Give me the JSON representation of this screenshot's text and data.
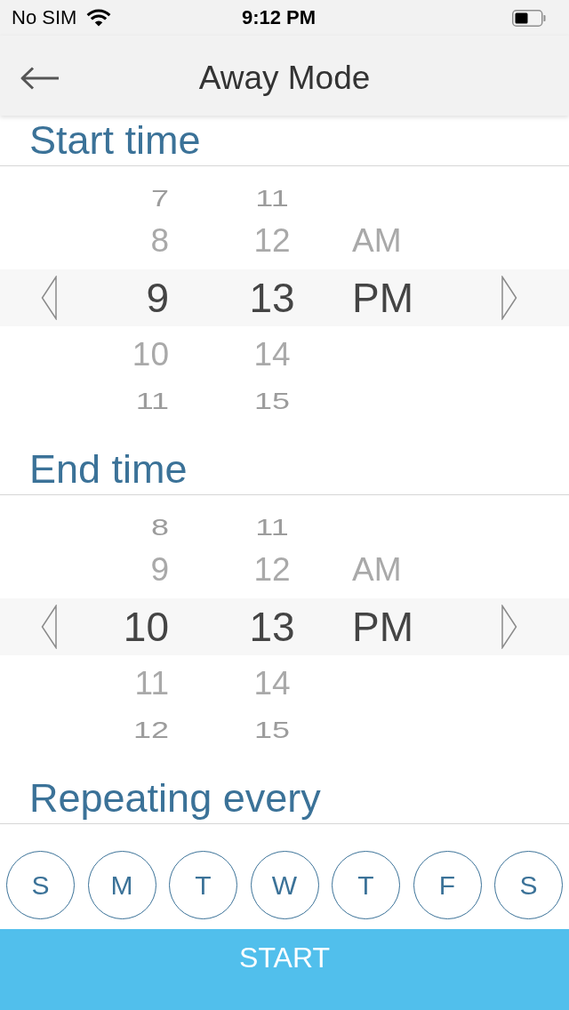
{
  "status_bar": {
    "carrier": "No SIM",
    "time": "9:12 PM"
  },
  "nav_bar": {
    "title": "Away Mode"
  },
  "start_time": {
    "heading": "Start time",
    "columns": [
      {
        "kind": "hour",
        "items": [
          {
            "label": "7",
            "selected": false
          },
          {
            "label": "8",
            "selected": false
          },
          {
            "label": "9",
            "selected": true
          },
          {
            "label": "10",
            "selected": false
          },
          {
            "label": "11",
            "selected": false
          }
        ]
      },
      {
        "kind": "minute",
        "items": [
          {
            "label": "11",
            "selected": false
          },
          {
            "label": "12",
            "selected": false
          },
          {
            "label": "13",
            "selected": true
          },
          {
            "label": "14",
            "selected": false
          },
          {
            "label": "15",
            "selected": false
          }
        ]
      },
      {
        "kind": "period",
        "items": [
          {
            "label": "AM",
            "selected": false
          },
          {
            "label": "PM",
            "selected": true
          }
        ]
      }
    ]
  },
  "end_time": {
    "heading": "End time",
    "columns": [
      {
        "kind": "hour",
        "items": [
          {
            "label": "8",
            "selected": false
          },
          {
            "label": "9",
            "selected": false
          },
          {
            "label": "10",
            "selected": true
          },
          {
            "label": "11",
            "selected": false
          },
          {
            "label": "12",
            "selected": false
          }
        ]
      },
      {
        "kind": "minute",
        "items": [
          {
            "label": "11",
            "selected": false
          },
          {
            "label": "12",
            "selected": false
          },
          {
            "label": "13",
            "selected": true
          },
          {
            "label": "14",
            "selected": false
          },
          {
            "label": "15",
            "selected": false
          }
        ]
      },
      {
        "kind": "period",
        "items": [
          {
            "label": "AM",
            "selected": false
          },
          {
            "label": "PM",
            "selected": true
          }
        ]
      }
    ]
  },
  "repeat": {
    "heading": "Repeating every",
    "days": [
      {
        "label": "S",
        "selected": false
      },
      {
        "label": "M",
        "selected": false
      },
      {
        "label": "T",
        "selected": false
      },
      {
        "label": "W",
        "selected": false
      },
      {
        "label": "T",
        "selected": false
      },
      {
        "label": "F",
        "selected": false
      },
      {
        "label": "S",
        "selected": false
      }
    ]
  },
  "start_button": {
    "label": "START"
  }
}
